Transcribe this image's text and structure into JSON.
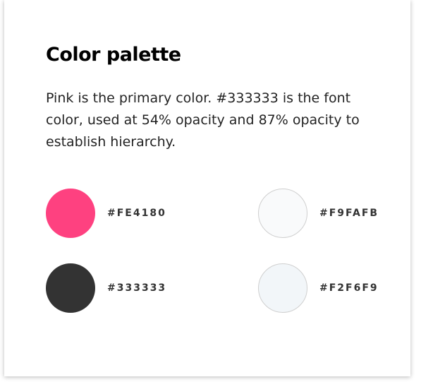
{
  "heading": "Color palette",
  "description": "Pink is the primary color. #333333 is the font color, used at 54% opacity and 87% opacity to establish hierarchy.",
  "swatches": [
    {
      "hex": "#FE4180",
      "color": "#FE4180"
    },
    {
      "hex": "#F9FAFB",
      "color": "#F9FAFB"
    },
    {
      "hex": "#333333",
      "color": "#333333"
    },
    {
      "hex": "#F2F6F9",
      "color": "#F2F6F9"
    }
  ]
}
